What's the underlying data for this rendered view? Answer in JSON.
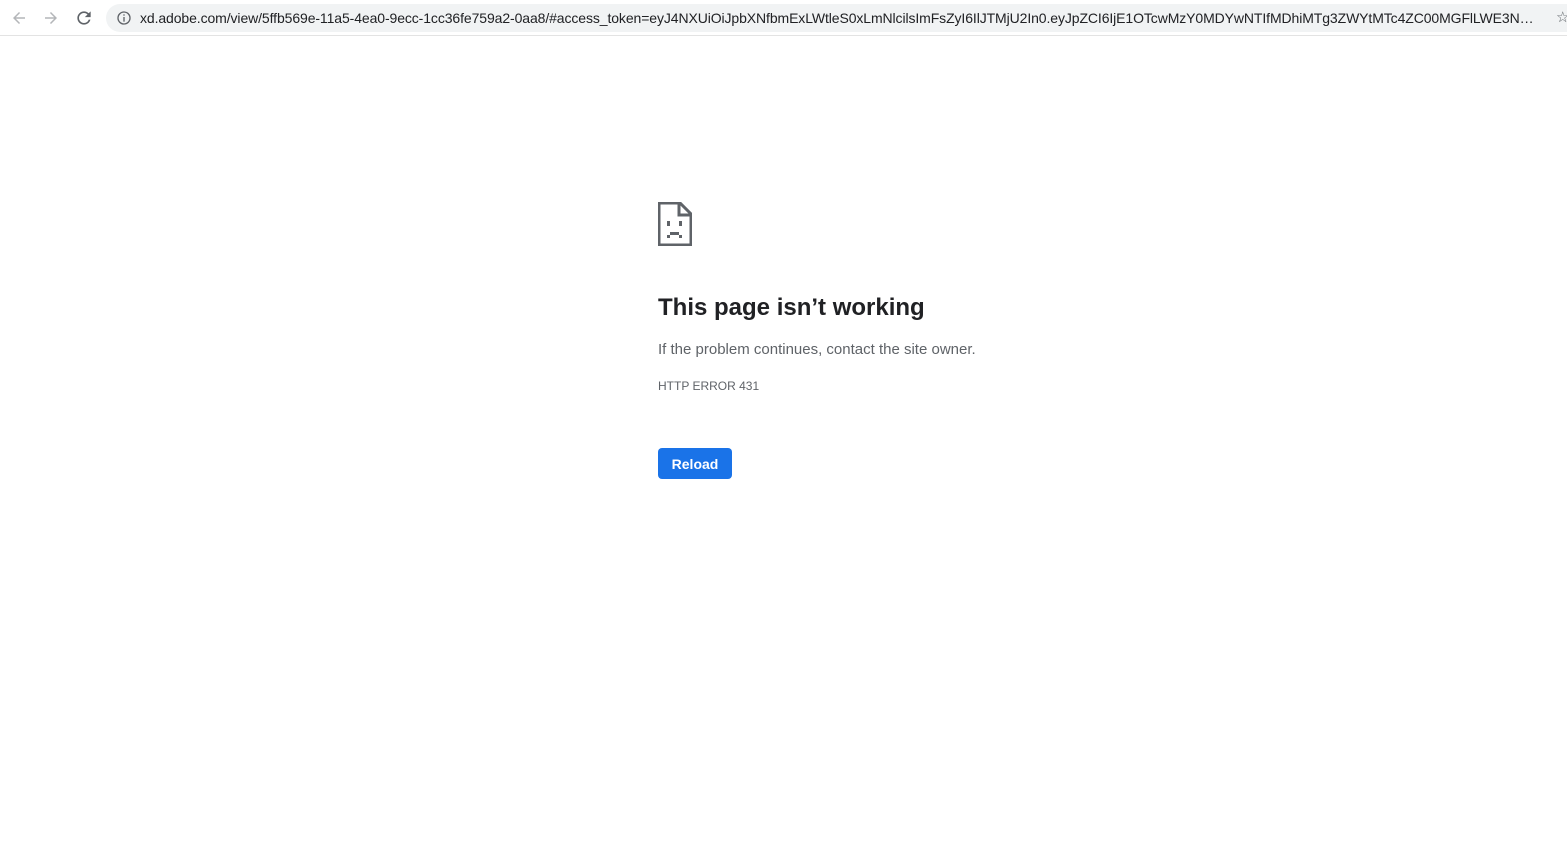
{
  "browser": {
    "url": "xd.adobe.com/view/5ffb569e-11a5-4ea0-9ecc-1cc36fe759a2-0aa8/#access_token=eyJ4NXUiOiJpbXNfbmExLWtleS0xLmNlcilsImFsZyI6IlJTMjU2In0.eyJpZCI6IjE1OTcwMzY0MDYwNTIfMDhiMTg3ZWYtMTc4ZC00MGFlLWE3NzYtNG...",
    "icons": {
      "back": "arrow-left-icon",
      "forward": "arrow-right-icon",
      "reload": "reload-icon",
      "site_info": "info-icon",
      "bookmark": "star-icon"
    }
  },
  "error_page": {
    "icon": "sad-page-icon",
    "heading": "This page isn’t working",
    "message": "If the problem continues, contact the site owner.",
    "code": "HTTP ERROR 431",
    "reload_label": "Reload",
    "accent_color": "#1a73e8"
  }
}
